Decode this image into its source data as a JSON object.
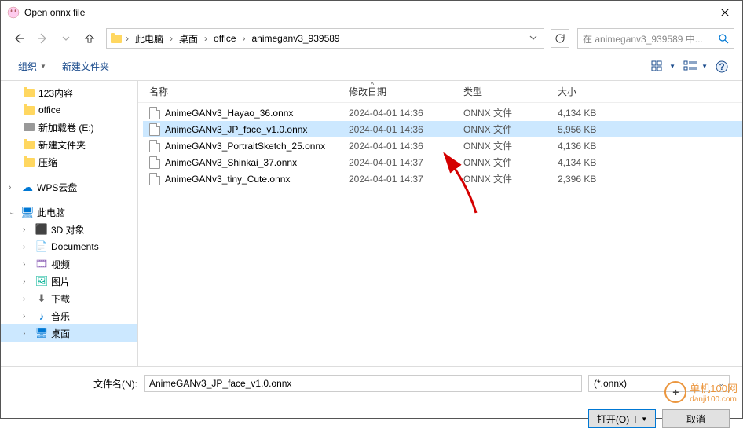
{
  "title": "Open onnx file",
  "breadcrumb": {
    "seg1": "此电脑",
    "seg2": "桌面",
    "seg3": "office",
    "seg4": "animeganv3_939589"
  },
  "search_placeholder": "在 animeganv3_939589 中...",
  "toolbar": {
    "organize": "组织",
    "newfolder": "新建文件夹"
  },
  "sidebar": {
    "items": [
      {
        "label": "123内容"
      },
      {
        "label": "office"
      },
      {
        "label": "新加载卷 (E:)"
      },
      {
        "label": "新建文件夹"
      },
      {
        "label": "压缩"
      },
      {
        "label": "WPS云盘"
      },
      {
        "label": "此电脑"
      },
      {
        "label": "3D 对象"
      },
      {
        "label": "Documents"
      },
      {
        "label": "视频"
      },
      {
        "label": "图片"
      },
      {
        "label": "下载"
      },
      {
        "label": "音乐"
      },
      {
        "label": "桌面"
      }
    ]
  },
  "columns": {
    "name": "名称",
    "date": "修改日期",
    "type": "类型",
    "size": "大小"
  },
  "files": [
    {
      "name": "AnimeGANv3_Hayao_36.onnx",
      "date": "2024-04-01 14:36",
      "type": "ONNX 文件",
      "size": "4,134 KB"
    },
    {
      "name": "AnimeGANv3_JP_face_v1.0.onnx",
      "date": "2024-04-01 14:36",
      "type": "ONNX 文件",
      "size": "5,956 KB"
    },
    {
      "name": "AnimeGANv3_PortraitSketch_25.onnx",
      "date": "2024-04-01 14:36",
      "type": "ONNX 文件",
      "size": "4,136 KB"
    },
    {
      "name": "AnimeGANv3_Shinkai_37.onnx",
      "date": "2024-04-01 14:37",
      "type": "ONNX 文件",
      "size": "4,134 KB"
    },
    {
      "name": "AnimeGANv3_tiny_Cute.onnx",
      "date": "2024-04-01 14:37",
      "type": "ONNX 文件",
      "size": "2,396 KB"
    }
  ],
  "filename_label": "文件名(N):",
  "filename_value": "AnimeGANv3_JP_face_v1.0.onnx",
  "filter": "(*.onnx)",
  "open_btn": "打开(O)",
  "cancel_btn": "取消",
  "watermark": {
    "main": "单机100网",
    "sub": "danji100.com"
  }
}
